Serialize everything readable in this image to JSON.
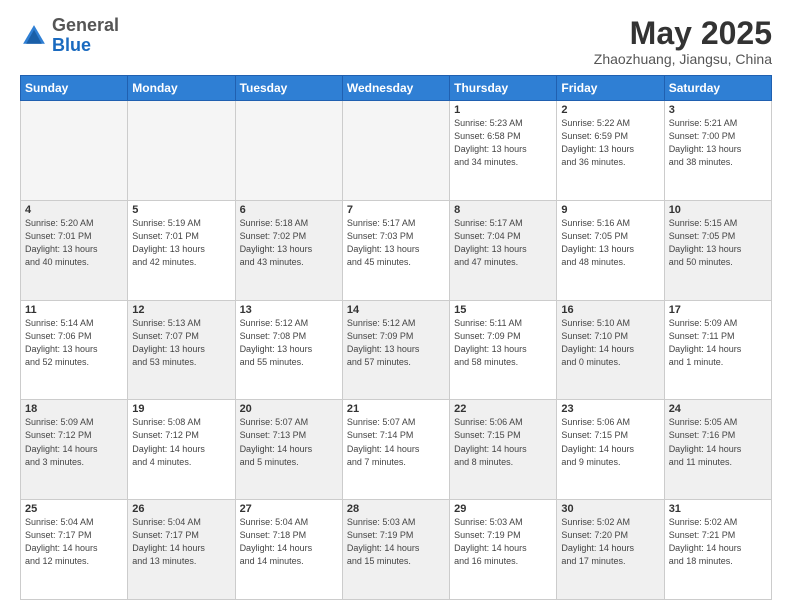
{
  "header": {
    "logo_general": "General",
    "logo_blue": "Blue",
    "month_year": "May 2025",
    "location": "Zhaozhuang, Jiangsu, China"
  },
  "weekdays": [
    "Sunday",
    "Monday",
    "Tuesday",
    "Wednesday",
    "Thursday",
    "Friday",
    "Saturday"
  ],
  "weeks": [
    [
      {
        "day": "",
        "info": "",
        "empty": true
      },
      {
        "day": "",
        "info": "",
        "empty": true
      },
      {
        "day": "",
        "info": "",
        "empty": true
      },
      {
        "day": "",
        "info": "",
        "empty": true
      },
      {
        "day": "1",
        "info": "Sunrise: 5:23 AM\nSunset: 6:58 PM\nDaylight: 13 hours\nand 34 minutes."
      },
      {
        "day": "2",
        "info": "Sunrise: 5:22 AM\nSunset: 6:59 PM\nDaylight: 13 hours\nand 36 minutes."
      },
      {
        "day": "3",
        "info": "Sunrise: 5:21 AM\nSunset: 7:00 PM\nDaylight: 13 hours\nand 38 minutes."
      }
    ],
    [
      {
        "day": "4",
        "info": "Sunrise: 5:20 AM\nSunset: 7:01 PM\nDaylight: 13 hours\nand 40 minutes.",
        "shade": true
      },
      {
        "day": "5",
        "info": "Sunrise: 5:19 AM\nSunset: 7:01 PM\nDaylight: 13 hours\nand 42 minutes."
      },
      {
        "day": "6",
        "info": "Sunrise: 5:18 AM\nSunset: 7:02 PM\nDaylight: 13 hours\nand 43 minutes.",
        "shade": true
      },
      {
        "day": "7",
        "info": "Sunrise: 5:17 AM\nSunset: 7:03 PM\nDaylight: 13 hours\nand 45 minutes."
      },
      {
        "day": "8",
        "info": "Sunrise: 5:17 AM\nSunset: 7:04 PM\nDaylight: 13 hours\nand 47 minutes.",
        "shade": true
      },
      {
        "day": "9",
        "info": "Sunrise: 5:16 AM\nSunset: 7:05 PM\nDaylight: 13 hours\nand 48 minutes."
      },
      {
        "day": "10",
        "info": "Sunrise: 5:15 AM\nSunset: 7:05 PM\nDaylight: 13 hours\nand 50 minutes.",
        "shade": true
      }
    ],
    [
      {
        "day": "11",
        "info": "Sunrise: 5:14 AM\nSunset: 7:06 PM\nDaylight: 13 hours\nand 52 minutes."
      },
      {
        "day": "12",
        "info": "Sunrise: 5:13 AM\nSunset: 7:07 PM\nDaylight: 13 hours\nand 53 minutes.",
        "shade": true
      },
      {
        "day": "13",
        "info": "Sunrise: 5:12 AM\nSunset: 7:08 PM\nDaylight: 13 hours\nand 55 minutes."
      },
      {
        "day": "14",
        "info": "Sunrise: 5:12 AM\nSunset: 7:09 PM\nDaylight: 13 hours\nand 57 minutes.",
        "shade": true
      },
      {
        "day": "15",
        "info": "Sunrise: 5:11 AM\nSunset: 7:09 PM\nDaylight: 13 hours\nand 58 minutes."
      },
      {
        "day": "16",
        "info": "Sunrise: 5:10 AM\nSunset: 7:10 PM\nDaylight: 14 hours\nand 0 minutes.",
        "shade": true
      },
      {
        "day": "17",
        "info": "Sunrise: 5:09 AM\nSunset: 7:11 PM\nDaylight: 14 hours\nand 1 minute."
      }
    ],
    [
      {
        "day": "18",
        "info": "Sunrise: 5:09 AM\nSunset: 7:12 PM\nDaylight: 14 hours\nand 3 minutes.",
        "shade": true
      },
      {
        "day": "19",
        "info": "Sunrise: 5:08 AM\nSunset: 7:12 PM\nDaylight: 14 hours\nand 4 minutes."
      },
      {
        "day": "20",
        "info": "Sunrise: 5:07 AM\nSunset: 7:13 PM\nDaylight: 14 hours\nand 5 minutes.",
        "shade": true
      },
      {
        "day": "21",
        "info": "Sunrise: 5:07 AM\nSunset: 7:14 PM\nDaylight: 14 hours\nand 7 minutes."
      },
      {
        "day": "22",
        "info": "Sunrise: 5:06 AM\nSunset: 7:15 PM\nDaylight: 14 hours\nand 8 minutes.",
        "shade": true
      },
      {
        "day": "23",
        "info": "Sunrise: 5:06 AM\nSunset: 7:15 PM\nDaylight: 14 hours\nand 9 minutes."
      },
      {
        "day": "24",
        "info": "Sunrise: 5:05 AM\nSunset: 7:16 PM\nDaylight: 14 hours\nand 11 minutes.",
        "shade": true
      }
    ],
    [
      {
        "day": "25",
        "info": "Sunrise: 5:04 AM\nSunset: 7:17 PM\nDaylight: 14 hours\nand 12 minutes."
      },
      {
        "day": "26",
        "info": "Sunrise: 5:04 AM\nSunset: 7:17 PM\nDaylight: 14 hours\nand 13 minutes.",
        "shade": true
      },
      {
        "day": "27",
        "info": "Sunrise: 5:04 AM\nSunset: 7:18 PM\nDaylight: 14 hours\nand 14 minutes."
      },
      {
        "day": "28",
        "info": "Sunrise: 5:03 AM\nSunset: 7:19 PM\nDaylight: 14 hours\nand 15 minutes.",
        "shade": true
      },
      {
        "day": "29",
        "info": "Sunrise: 5:03 AM\nSunset: 7:19 PM\nDaylight: 14 hours\nand 16 minutes."
      },
      {
        "day": "30",
        "info": "Sunrise: 5:02 AM\nSunset: 7:20 PM\nDaylight: 14 hours\nand 17 minutes.",
        "shade": true
      },
      {
        "day": "31",
        "info": "Sunrise: 5:02 AM\nSunset: 7:21 PM\nDaylight: 14 hours\nand 18 minutes."
      }
    ]
  ]
}
